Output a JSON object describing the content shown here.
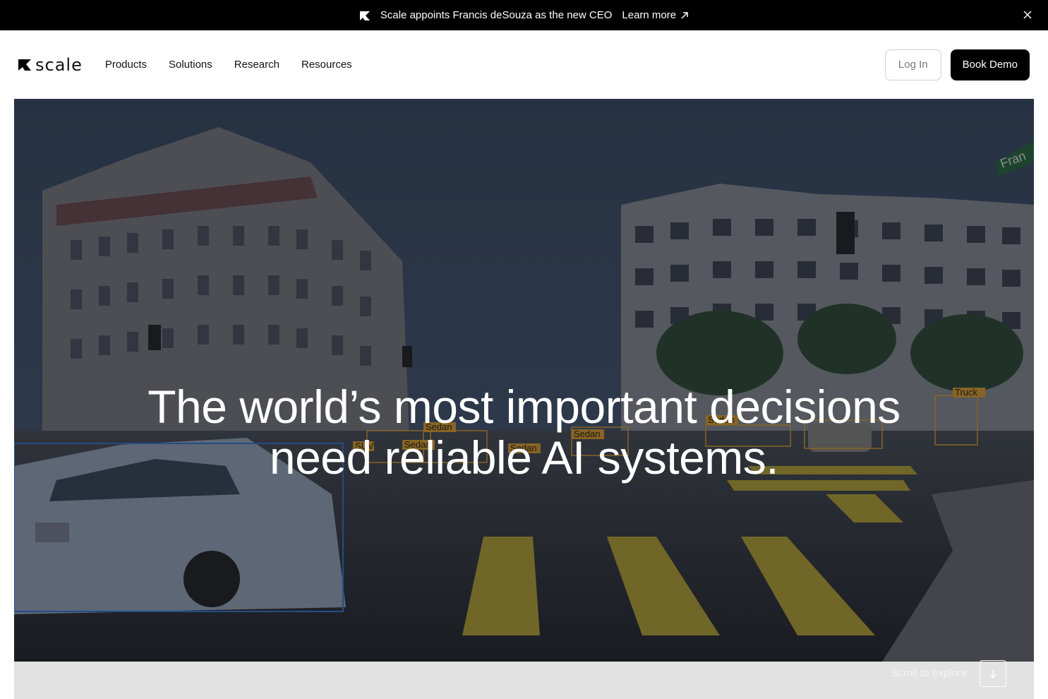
{
  "announcement": {
    "logo_icon": "scale-mark-icon",
    "text": "Scale appoints Francis deSouza as the new CEO",
    "link_label": "Learn more",
    "link_icon": "arrow-up-right-icon",
    "close_icon": "close-icon"
  },
  "nav": {
    "brand": "scale",
    "menu": [
      "Products",
      "Solutions",
      "Research",
      "Resources"
    ],
    "login_label": "Log In",
    "demo_label": "Book Demo"
  },
  "hero": {
    "title_line1": "The world’s most important decisions",
    "title_line2": "need reliable AI systems.",
    "labels": [
      "Sedan",
      "SUV",
      "Sedan",
      "Sedan",
      "Sedan",
      "Sedan",
      "Sedan",
      "Truck"
    ],
    "street_sign": "Fran"
  },
  "scroll": {
    "label": "Scroll to explore",
    "icon": "arrow-down-icon"
  },
  "colors": {
    "accent": "#000000",
    "box_orange": "#e0a030",
    "box_blue": "#3a78d8",
    "crosswalk": "#d8c040"
  }
}
